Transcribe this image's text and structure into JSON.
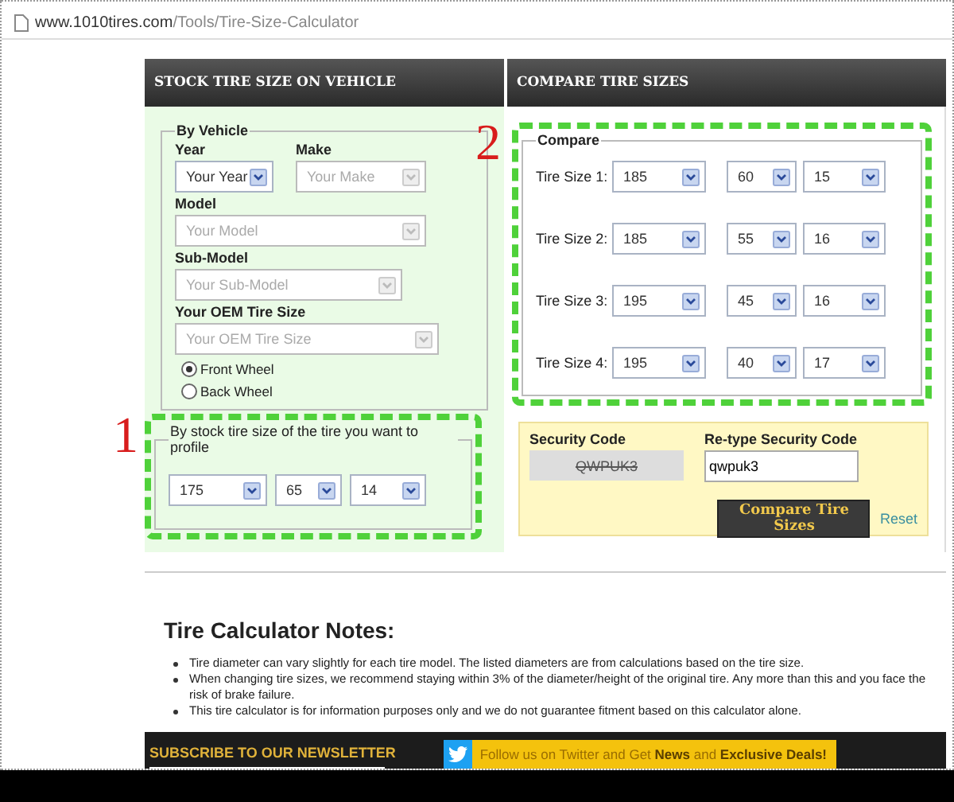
{
  "browser": {
    "url_domain": "www.1010tires.com",
    "url_path": "/Tools/Tire-Size-Calculator"
  },
  "headers": [
    "STOCK TIRE SIZE ON VEHICLE",
    "COMPARE TIRE SIZES"
  ],
  "by_vehicle": {
    "legend": "By Vehicle",
    "fields": [
      {
        "label": "Year",
        "value": "Your Year",
        "disabled": false
      },
      {
        "label": "Make",
        "value": "Your Make",
        "disabled": true
      },
      {
        "label": "Model",
        "value": "Your Model",
        "disabled": true
      },
      {
        "label": "Sub-Model",
        "value": "Your Sub-Model",
        "disabled": true
      },
      {
        "label": "Your OEM Tire Size",
        "value": "Your OEM Tire Size",
        "disabled": true
      }
    ],
    "wheels": [
      {
        "label": "Front Wheel",
        "selected": true
      },
      {
        "label": "Back Wheel",
        "selected": false
      }
    ]
  },
  "stock_size": {
    "legend": "By stock tire size of the tire you want to profile",
    "values": [
      "175",
      "65",
      "14"
    ]
  },
  "compare": {
    "legend": "Compare",
    "rows": [
      {
        "label": "Tire Size 1:",
        "values": [
          "185",
          "60",
          "15"
        ]
      },
      {
        "label": "Tire Size 2:",
        "values": [
          "185",
          "55",
          "16"
        ]
      },
      {
        "label": "Tire Size 3:",
        "values": [
          "195",
          "45",
          "16"
        ]
      },
      {
        "label": "Tire Size 4:",
        "values": [
          "195",
          "40",
          "17"
        ]
      }
    ]
  },
  "security": {
    "code_label": "Security Code",
    "code": "QWPUK3",
    "retype_label": "Re-type Security Code",
    "retype_value": "qwpuk3",
    "submit": "Compare Tire Sizes",
    "reset": "Reset"
  },
  "notes": {
    "title": "Tire Calculator Notes:",
    "items": [
      "Tire diameter can vary slightly for each tire model. The listed diameters are from calculations based on the tire size.",
      "When changing tire sizes, we recommend staying within 3% of the diameter/height of the original tire. Any more than this and you face the risk of brake failure.",
      "This tire calculator is for information purposes only and we do not guarantee fitment based on this calculator alone."
    ]
  },
  "footer": {
    "newsletter": "SUBSCRIBE TO OUR NEWSLETTER",
    "twitter": "Follow us on Twitter and Get **News** and **Exclusive Deals!**"
  },
  "annotations": [
    {
      "label": "1"
    },
    {
      "label": "2"
    }
  ]
}
